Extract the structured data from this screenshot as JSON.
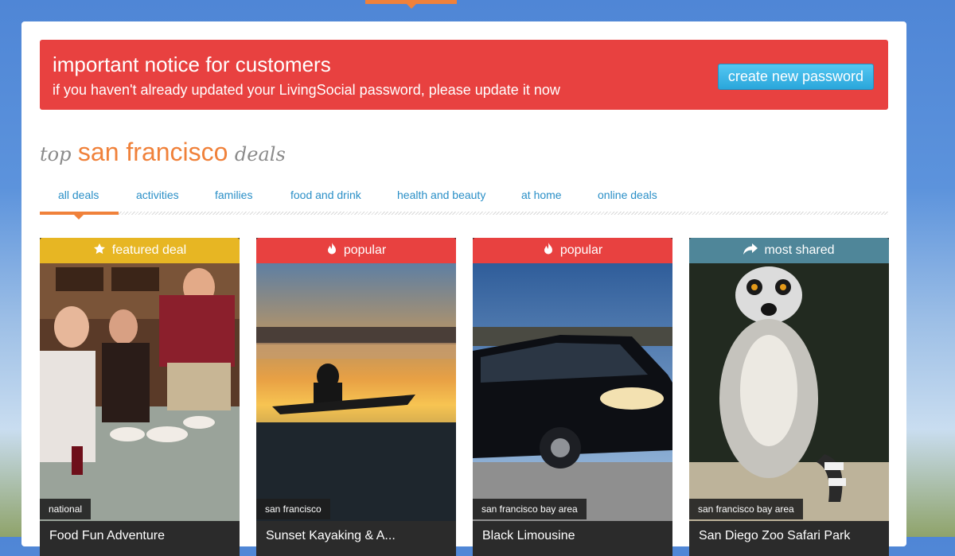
{
  "notice": {
    "title": "important notice for customers",
    "body": "if you haven't already updated your LivingSocial password, please update it now",
    "button_label": "create new password",
    "background_color": "#e84140"
  },
  "heading": {
    "prefix": "top",
    "city": "san francisco",
    "suffix": "deals"
  },
  "tabs": [
    {
      "label": "all deals",
      "active": true
    },
    {
      "label": "activities",
      "active": false
    },
    {
      "label": "families",
      "active": false
    },
    {
      "label": "food and drink",
      "active": false
    },
    {
      "label": "health and beauty",
      "active": false
    },
    {
      "label": "at home",
      "active": false
    },
    {
      "label": "online deals",
      "active": false
    }
  ],
  "cards": [
    {
      "banner": "featured deal",
      "banner_icon": "star-icon",
      "banner_color": "#e7b623",
      "location": "national",
      "title": "Food Fun Adventure"
    },
    {
      "banner": "popular",
      "banner_icon": "flame-icon",
      "banner_color": "#e84140",
      "location": "san francisco",
      "title": "Sunset Kayaking & A..."
    },
    {
      "banner": "popular",
      "banner_icon": "flame-icon",
      "banner_color": "#e84140",
      "location": "san francisco bay area",
      "title": "Black Limousine"
    },
    {
      "banner": "most shared",
      "banner_icon": "share-arrow-icon",
      "banner_color": "#4f8699",
      "location": "san francisco bay area",
      "title": "San Diego Zoo Safari Park"
    }
  ],
  "colors": {
    "accent": "#f0813a",
    "link": "#2a8fc7"
  }
}
